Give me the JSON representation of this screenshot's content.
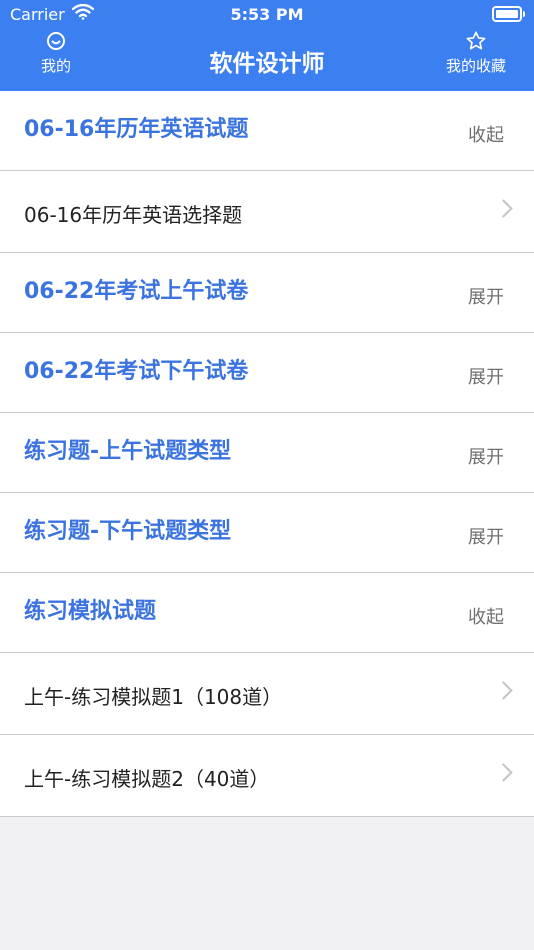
{
  "statusbar": {
    "carrier": "Carrier",
    "time": "5:53 PM"
  },
  "navbar": {
    "left_label": "我的",
    "title": "软件设计师",
    "right_label": "我的收藏"
  },
  "rows": [
    {
      "type": "section",
      "label": "06-16年历年英语试题",
      "action": "收起"
    },
    {
      "type": "item",
      "label": "06-16年历年英语选择题"
    },
    {
      "type": "section",
      "label": "06-22年考试上午试卷",
      "action": "展开"
    },
    {
      "type": "section",
      "label": "06-22年考试下午试卷",
      "action": "展开"
    },
    {
      "type": "section",
      "label": "练习题-上午试题类型",
      "action": "展开"
    },
    {
      "type": "section",
      "label": "练习题-下午试题类型",
      "action": "展开"
    },
    {
      "type": "section",
      "label": "练习模拟试题",
      "action": "收起"
    },
    {
      "type": "item",
      "label": "上午-练习模拟题1（108道）"
    },
    {
      "type": "item",
      "label": "上午-练习模拟题2（40道）"
    }
  ]
}
